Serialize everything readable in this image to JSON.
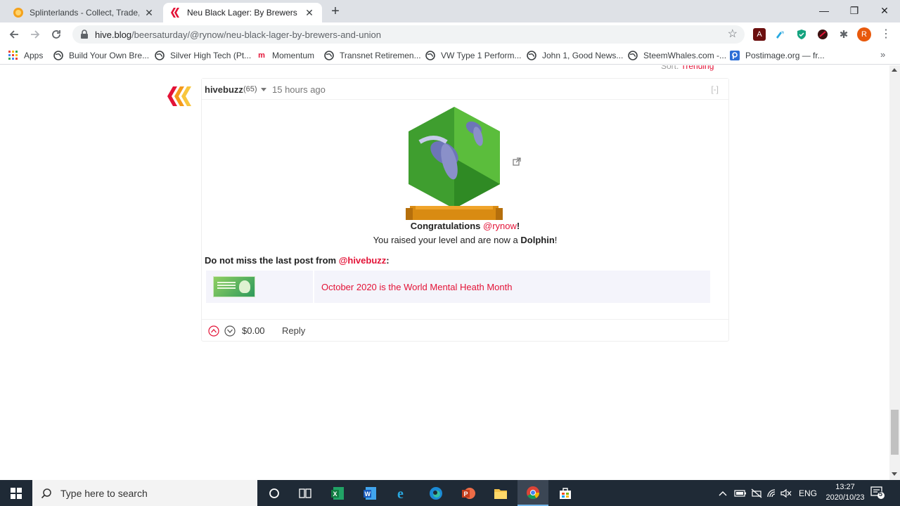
{
  "browser": {
    "tabs": [
      {
        "title": "Splinterlands - Collect, Trade, Bat",
        "active": false
      },
      {
        "title": "Neu Black Lager: By Brewers and",
        "active": true
      }
    ],
    "new_tab": "+",
    "close_glyph": "✕",
    "window_controls": {
      "minimize": "—",
      "maximize": "❐",
      "close": "✕"
    },
    "url": {
      "host": "hive.blog",
      "path": "/beersaturday/@rynow/neu-black-lager-by-brewers-and-union"
    },
    "profile_initial": "R",
    "bookmarks": [
      {
        "label": "Apps",
        "icon": "apps-grid-icon"
      },
      {
        "label": "Build Your Own Bre...",
        "icon": "globe-icon"
      },
      {
        "label": "Silver High Tech (Pt...",
        "icon": "globe-icon"
      },
      {
        "label": "Momentum",
        "icon": "momentum-icon"
      },
      {
        "label": "Transnet Retiremen...",
        "icon": "globe-icon"
      },
      {
        "label": "VW Type 1 Perform...",
        "icon": "globe-icon"
      },
      {
        "label": "John 1, Good News...",
        "icon": "globe-icon"
      },
      {
        "label": "SteemWhales.com -...",
        "icon": "globe-icon"
      },
      {
        "label": "Postimage.org — fr...",
        "icon": "postimage-icon"
      }
    ],
    "bookmarks_more": "»"
  },
  "page": {
    "sort_label": "Sort:",
    "sort_value": "Trending",
    "comment": {
      "author": "hivebuzz",
      "reputation": "(65)",
      "time": "15 hours ago",
      "collapse": "[-]",
      "congrats_prefix": "Congratulations",
      "congrats_mention": "@rynow",
      "congrats_suffix": "!",
      "raised_prefix": "You raised your level and are now a",
      "raised_level": "Dolphin",
      "raised_suffix": "!",
      "dnm_prefix": "Do not miss the last post from",
      "dnm_mention": "@hivebuzz",
      "dnm_suffix": ":",
      "last_post_title": "October 2020 is the World Mental Heath Month",
      "payout": "$0.00",
      "reply": "Reply"
    },
    "colors": {
      "accent": "#e31337",
      "badge_green": "#4caf3a",
      "badge_ribbon": "#d98b12"
    }
  },
  "taskbar": {
    "search_placeholder": "Type here to search",
    "apps": [
      "cortana-icon",
      "task-view-icon",
      "excel-icon",
      "word-icon",
      "ie-icon",
      "edge-icon",
      "powerpoint-icon",
      "file-explorer-icon",
      "chrome-icon",
      "store-icon"
    ],
    "language": "ENG",
    "time": "13:27",
    "date": "2020/10/23",
    "notification_count": "5"
  }
}
